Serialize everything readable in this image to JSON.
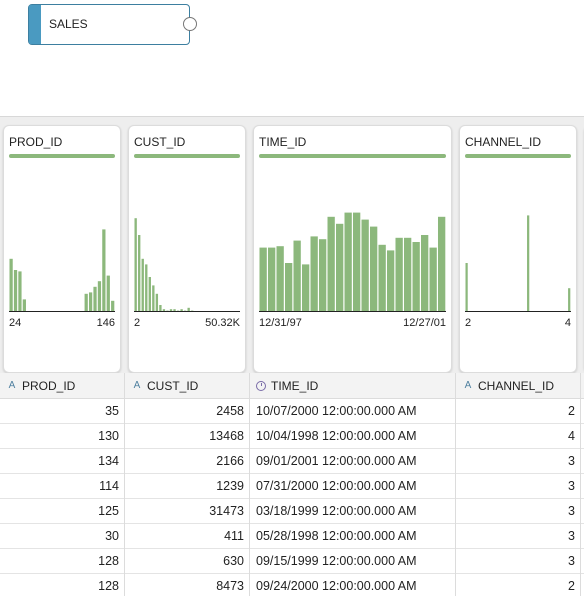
{
  "canvas": {
    "node_label": "SALES"
  },
  "columns": [
    {
      "key": "prod",
      "title": "PROD_ID",
      "type_icon": "A",
      "type": "string-type-icon",
      "align": "num",
      "axis_min": "24",
      "axis_max": "146",
      "hist": [
        0.38,
        0.3,
        0.29,
        0.09,
        0,
        0,
        0,
        0,
        0,
        0,
        0,
        0,
        0,
        0,
        0,
        0,
        0,
        0.13,
        0.14,
        0.18,
        0.22,
        0.59,
        0.26,
        0.08
      ],
      "values": [
        "35",
        "130",
        "134",
        "114",
        "125",
        "30",
        "128",
        "128"
      ]
    },
    {
      "key": "cust",
      "title": "CUST_ID",
      "type_icon": "A",
      "type": "string-type-icon",
      "align": "num",
      "axis_min": "2",
      "axis_max": "50.32K",
      "hist": [
        0.67,
        0.55,
        0.38,
        0.34,
        0.25,
        0.19,
        0.13,
        0.05,
        0.02,
        0.01,
        0.02,
        0.02,
        0.01,
        0.02,
        0.01,
        0.03,
        0.01,
        0,
        0,
        0,
        0,
        0,
        0,
        0,
        0,
        0,
        0,
        0,
        0,
        0
      ],
      "values": [
        "2458",
        "13468",
        "2166",
        "1239",
        "31473",
        "411",
        "630",
        "8473"
      ]
    },
    {
      "key": "time",
      "title": "TIME_ID",
      "type_icon": "clock",
      "type": "clock-icon",
      "align": "txt",
      "axis_min": "12/31/97",
      "axis_max": "12/27/01",
      "hist": [
        0.46,
        0.46,
        0.47,
        0.35,
        0.51,
        0.34,
        0.54,
        0.52,
        0.68,
        0.63,
        0.71,
        0.71,
        0.66,
        0.61,
        0.48,
        0.44,
        0.53,
        0.53,
        0.5,
        0.55,
        0.46,
        0.68
      ],
      "values": [
        "10/07/2000 12:00:00.000 AM",
        "10/04/1998 12:00:00.000 AM",
        "09/01/2001 12:00:00.000 AM",
        "07/31/2000 12:00:00.000 AM",
        "03/18/1999 12:00:00.000 AM",
        "05/28/1998 12:00:00.000 AM",
        "09/15/1999 12:00:00.000 AM",
        "09/24/2000 12:00:00.000 AM"
      ]
    },
    {
      "key": "channel",
      "title": "CHANNEL_ID",
      "type_icon": "A",
      "type": "string-type-icon",
      "align": "num",
      "axis_min": "2",
      "axis_max": "4",
      "hist": [
        0.35,
        0,
        0,
        0,
        0,
        0,
        0,
        0,
        0,
        0,
        0,
        0,
        0,
        0,
        0,
        0,
        0,
        0,
        0.69,
        0,
        0,
        0,
        0,
        0,
        0,
        0,
        0,
        0,
        0,
        0,
        0.17
      ],
      "values": [
        "2",
        "4",
        "3",
        "3",
        "3",
        "3",
        "3",
        "2"
      ]
    },
    {
      "key": "extra",
      "title": "",
      "type_icon": "",
      "type": "",
      "align": "num",
      "axis_min": "",
      "axis_max": "",
      "hist": [
        0.22,
        0.23,
        0.13,
        0.37
      ],
      "values": [
        "",
        "",
        "",
        "",
        "",
        "",
        "",
        ""
      ]
    }
  ],
  "colors": {
    "bar": "#8cb87c",
    "accent": "#4a9ac1"
  }
}
